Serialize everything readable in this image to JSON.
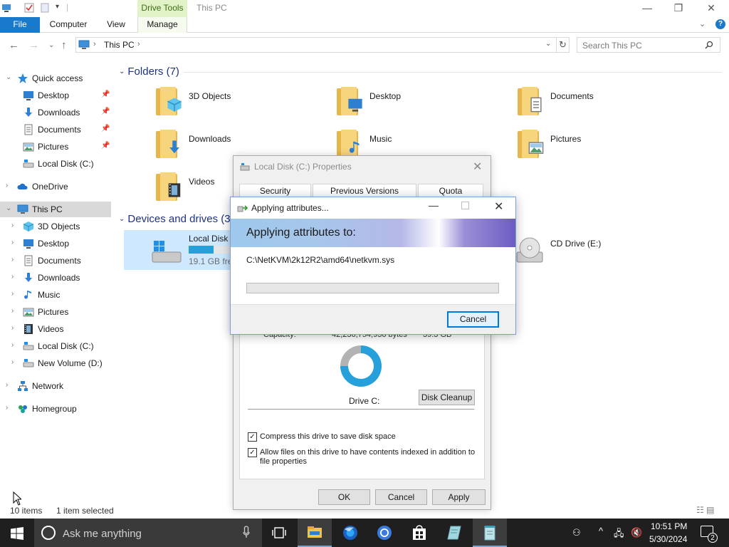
{
  "window": {
    "title": "This PC",
    "contextual_tab": "Drive Tools",
    "minimize": "—",
    "maximize": "❐",
    "close": "✕"
  },
  "ribbon": {
    "tabs": [
      "File",
      "Computer",
      "View",
      "Manage"
    ],
    "expand": "⌄",
    "help": "?"
  },
  "address_bar": {
    "back": "←",
    "forward": "→",
    "recent": "⌄",
    "up": "↑",
    "path": "This PC",
    "separator": "›",
    "dropdown": "⌄",
    "refresh": "↻",
    "search_placeholder": "Search This PC",
    "search_icon": "search-icon"
  },
  "sidebar": {
    "items": [
      {
        "label": "Quick access",
        "icon": "star-icon",
        "pinned": false,
        "expander": "⌄"
      },
      {
        "label": "Desktop",
        "icon": "desktop-icon",
        "pinned": true
      },
      {
        "label": "Downloads",
        "icon": "download-arrow-icon",
        "pinned": true
      },
      {
        "label": "Documents",
        "icon": "documents-icon",
        "pinned": true
      },
      {
        "label": "Pictures",
        "icon": "pictures-icon",
        "pinned": true
      },
      {
        "label": "Local Disk (C:)",
        "icon": "drive-icon",
        "pinned": false
      },
      {
        "label": "OneDrive",
        "icon": "cloud-icon",
        "expander": "›"
      },
      {
        "label": "This PC",
        "icon": "computer-icon",
        "expander": "⌄",
        "selected": true
      },
      {
        "label": "3D Objects",
        "icon": "cube-icon",
        "expander": "›"
      },
      {
        "label": "Desktop",
        "icon": "desktop-icon",
        "expander": "›"
      },
      {
        "label": "Documents",
        "icon": "documents-icon",
        "expander": "›"
      },
      {
        "label": "Downloads",
        "icon": "download-arrow-icon",
        "expander": "›"
      },
      {
        "label": "Music",
        "icon": "music-note-icon",
        "expander": "›"
      },
      {
        "label": "Pictures",
        "icon": "pictures-icon",
        "expander": "›"
      },
      {
        "label": "Videos",
        "icon": "film-icon",
        "expander": "›"
      },
      {
        "label": "Local Disk (C:)",
        "icon": "drive-icon",
        "expander": "›"
      },
      {
        "label": "New Volume (D:)",
        "icon": "drive-icon",
        "expander": "›"
      },
      {
        "label": "Network",
        "icon": "network-icon",
        "expander": "›"
      },
      {
        "label": "Homegroup",
        "icon": "homegroup-icon",
        "expander": "›"
      }
    ],
    "pin_glyph": "📌"
  },
  "main": {
    "folders_heading": "Folders (7)",
    "folders": [
      {
        "label": "3D Objects",
        "badge": "cube-icon"
      },
      {
        "label": "Desktop",
        "badge": "desktop-icon"
      },
      {
        "label": "Documents",
        "badge": "documents-icon"
      },
      {
        "label": "Downloads",
        "badge": "download-arrow-icon"
      },
      {
        "label": "Music",
        "badge": "music-note-icon"
      },
      {
        "label": "Pictures",
        "badge": "pictures-icon"
      },
      {
        "label": "Videos",
        "badge": "film-icon"
      }
    ],
    "devices_heading": "Devices and drives (3",
    "drives": [
      {
        "label": "Local Disk (",
        "free": "19.1 GB free",
        "used_fraction": 0.55
      },
      {
        "label": "CD Drive (E:)"
      }
    ],
    "group_chevron": "⌄"
  },
  "status_bar": {
    "items": "10 items",
    "selected": "1 item selected",
    "view_icons": "☷ ▤"
  },
  "properties_dialog": {
    "title": "Local Disk (C:) Properties",
    "close": "✕",
    "tabs": [
      "Security",
      "Previous Versions",
      "Quota"
    ],
    "capacity_label": "Capacity:",
    "capacity_bytes": "42,236,754,936 bytes",
    "capacity_gb": "39.3 GB",
    "used_fraction": 0.75,
    "drive_label": "Drive C:",
    "disk_cleanup": "Disk Cleanup",
    "compress_label": "Compress this drive to save disk space",
    "compress_checked": true,
    "index_label": "Allow files on this drive to have contents indexed in addition to file properties",
    "index_checked": true,
    "check_glyph": "✓",
    "ok": "OK",
    "cancel": "Cancel",
    "apply": "Apply"
  },
  "apply_dialog": {
    "title": "Applying attributes...",
    "minimize": "—",
    "close": "✕",
    "heading": "Applying attributes to:",
    "path": "C:\\NetKVM\\2k12R2\\amd64\\netkvm.sys",
    "progress": 0.0,
    "cancel": "Cancel"
  },
  "taskbar": {
    "search_placeholder": "Ask me anything",
    "apps": [
      "task-view-icon",
      "file-explorer-icon",
      "firefox-icon",
      "chrome-icon",
      "store-icon",
      "app-icon",
      "notepad-icon"
    ],
    "tray": {
      "people": "⚇",
      "chevron": "^",
      "network": "🖧",
      "volume": "🔇",
      "time": "10:51 PM",
      "date": "5/30/2024",
      "notifications": "2"
    }
  },
  "colors": {
    "accent": "#1979ca",
    "drive_tools_bg": "#e2f4c7",
    "selected_row": "#d9d9d9",
    "drive_bar": "#26a0da",
    "taskbar": "#1f1f1f"
  }
}
